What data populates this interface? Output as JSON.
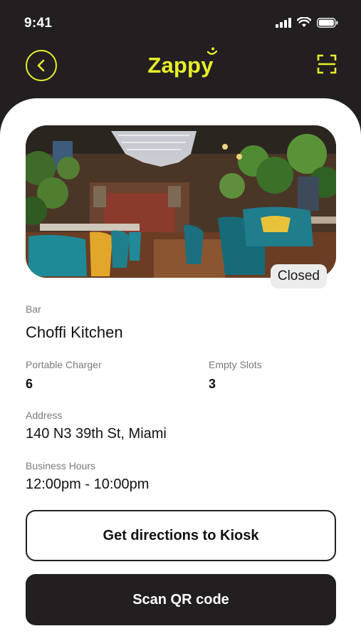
{
  "status_bar": {
    "time": "9:41"
  },
  "nav": {
    "logo": "Zappy"
  },
  "venue": {
    "closed_badge": "Closed",
    "type_label": "Bar",
    "name": "Choffi Kitchen",
    "charger_label": "Portable Charger",
    "charger_value": "6",
    "slots_label": "Empty Slots",
    "slots_value": "3",
    "address_label": "Address",
    "address_value": "140 N3 39th St, Miami",
    "hours_label": "Business Hours",
    "hours_value": "12:00pm - 10:00pm"
  },
  "actions": {
    "directions_label": "Get directions to Kiosk",
    "scan_label": "Scan QR code"
  },
  "colors": {
    "accent": "#e6ef2a",
    "dark": "#231f20"
  }
}
